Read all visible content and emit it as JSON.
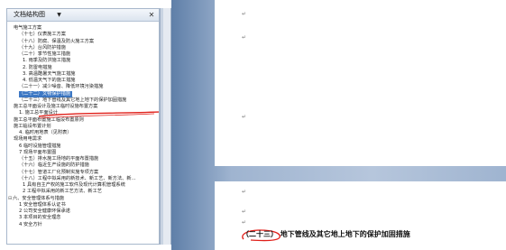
{
  "nav_pane": {
    "title": "文档结构图",
    "dropdown_icon": "chevron-down-icon",
    "close_icon": "close-icon",
    "items": [
      {
        "label": "电气施工方案",
        "level": 1
      },
      {
        "label": "（十七）仪表施工方案",
        "level": 2
      },
      {
        "label": "（十八）防腐、保温及防火施工方案",
        "level": 2
      },
      {
        "label": "（十九）台风防护措施",
        "level": 2
      },
      {
        "label": "（二十）季节性施工措施",
        "level": 2
      },
      {
        "label": "1. 雨季及防洪施工措施",
        "level": 3
      },
      {
        "label": "2. 防雷电措施",
        "level": 3
      },
      {
        "label": "3. 高温酷暑天气施工措施",
        "level": 3
      },
      {
        "label": "4. 低温天气下的施工措施",
        "level": 3
      },
      {
        "label": "（二十一）减少噪音、降低环境污染措施",
        "level": 2
      },
      {
        "label": "（二十二）文物保护措施",
        "level": 2,
        "selected": true
      },
      {
        "label": "（二十三）地下管线及其它地上地下的保护加固措施",
        "level": 2
      },
      {
        "label": "施工总平面设计及施工临时设施布置方案",
        "level": 1
      },
      {
        "label": "1. 施工总平面设计",
        "level": 2
      },
      {
        "label": "施工总平面布置施工临设布置原则",
        "level": 1
      },
      {
        "label": "施工临设布置计划",
        "level": 1
      },
      {
        "label": "4. 临时用地表（见附表）",
        "level": 2
      },
      {
        "label": "现场用电需求",
        "level": 1
      },
      {
        "label": "6 临时设施管理措施",
        "level": 2
      },
      {
        "label": "7 现场平面布置图",
        "level": 2
      },
      {
        "label": "（十五）排水施工场地的平面布置措施",
        "level": 2
      },
      {
        "label": "（十六）临近生产设施的防护措施",
        "level": 2
      },
      {
        "label": "（十七）管道工厂化预制实施专项方案",
        "level": 2
      },
      {
        "label": "（十八）工程中拟采用的新技术、新工艺、新方法、新…",
        "level": 2
      },
      {
        "label": "1 具有自主产权的施工软件及现代计算机管理系统",
        "level": 3
      },
      {
        "label": "2 工程中拟采用的新工艺方法、新工艺",
        "level": 3
      },
      {
        "label": "六、安全管理体系与措施",
        "level": 1,
        "toggle": "⊟"
      },
      {
        "label": "1 安全管理体系认证书",
        "level": 2
      },
      {
        "label": "2 公司安全健康环保承诺",
        "level": 2
      },
      {
        "label": "3 本项目的安全理念",
        "level": 2
      },
      {
        "label": "4 安全方针",
        "level": 2
      }
    ]
  },
  "document": {
    "paragraph_mark": "↵",
    "heading": "（二十三）  地下管线及其它地上地下的保护加固措施"
  },
  "colors": {
    "selection": "#3d78c4",
    "annotation": "#e0201a"
  }
}
